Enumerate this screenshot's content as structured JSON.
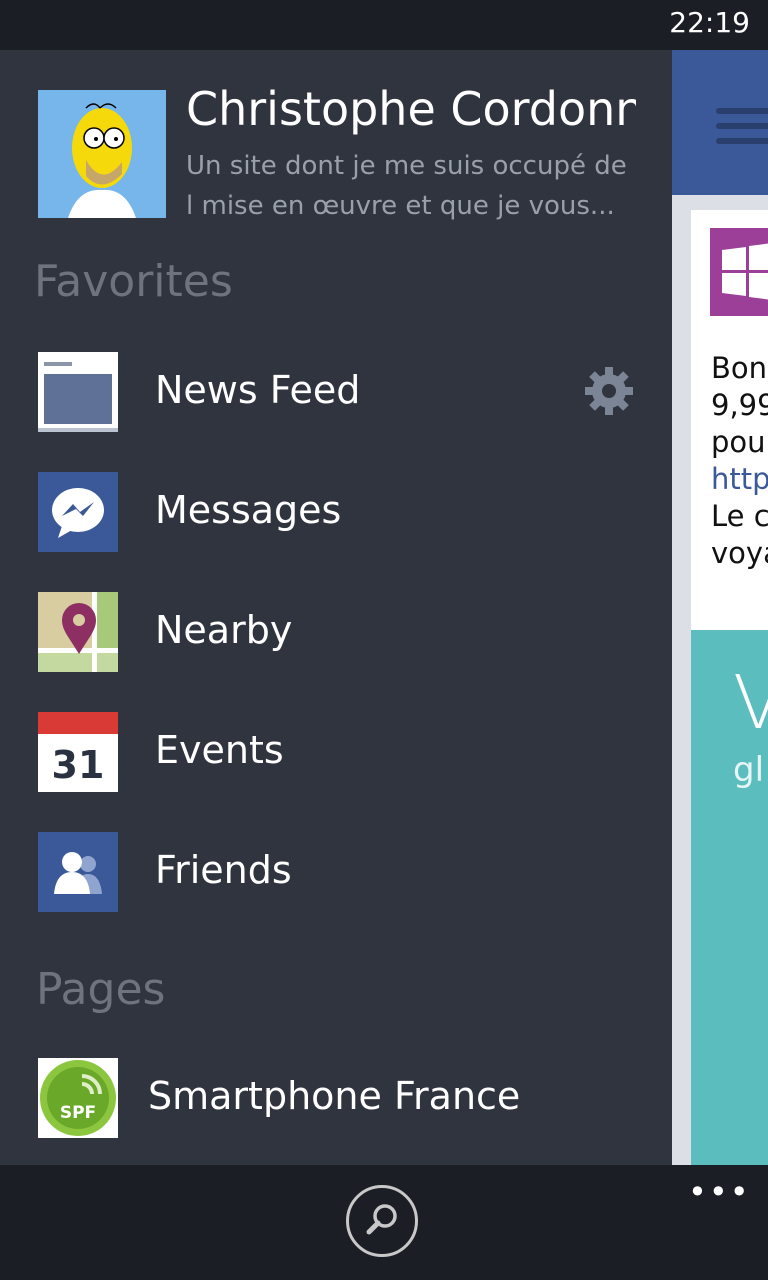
{
  "status_bar": {
    "time": "22:19"
  },
  "profile": {
    "name": "Christophe Cordonn",
    "status": "Un site dont je me suis occupé de l mise en œuvre et que je vous..."
  },
  "favorites": {
    "title": "Favorites",
    "items": [
      {
        "label": "News Feed",
        "icon": "news-feed-icon"
      },
      {
        "label": "Messages",
        "icon": "messages-icon"
      },
      {
        "label": "Nearby",
        "icon": "nearby-map-icon"
      },
      {
        "label": "Events",
        "icon": "calendar-icon",
        "day": "31"
      },
      {
        "label": "Friends",
        "icon": "friends-icon"
      }
    ]
  },
  "pages": {
    "title": "Pages",
    "items": [
      {
        "label": "Smartphone France",
        "icon": "spf-logo-icon",
        "logo_text": "SPF"
      }
    ]
  },
  "content_preview": {
    "lines": [
      "Bon",
      "9,99",
      "pou",
      "http",
      "Le c",
      "voya"
    ],
    "teal_big": "V",
    "teal_small": "gl"
  },
  "app_bar": {
    "more": "•••"
  },
  "colors": {
    "sidebar_bg": "#30343e",
    "facebook_blue": "#3b5998",
    "teal": "#5cbdbf",
    "windows_purple": "#9b3f98"
  }
}
